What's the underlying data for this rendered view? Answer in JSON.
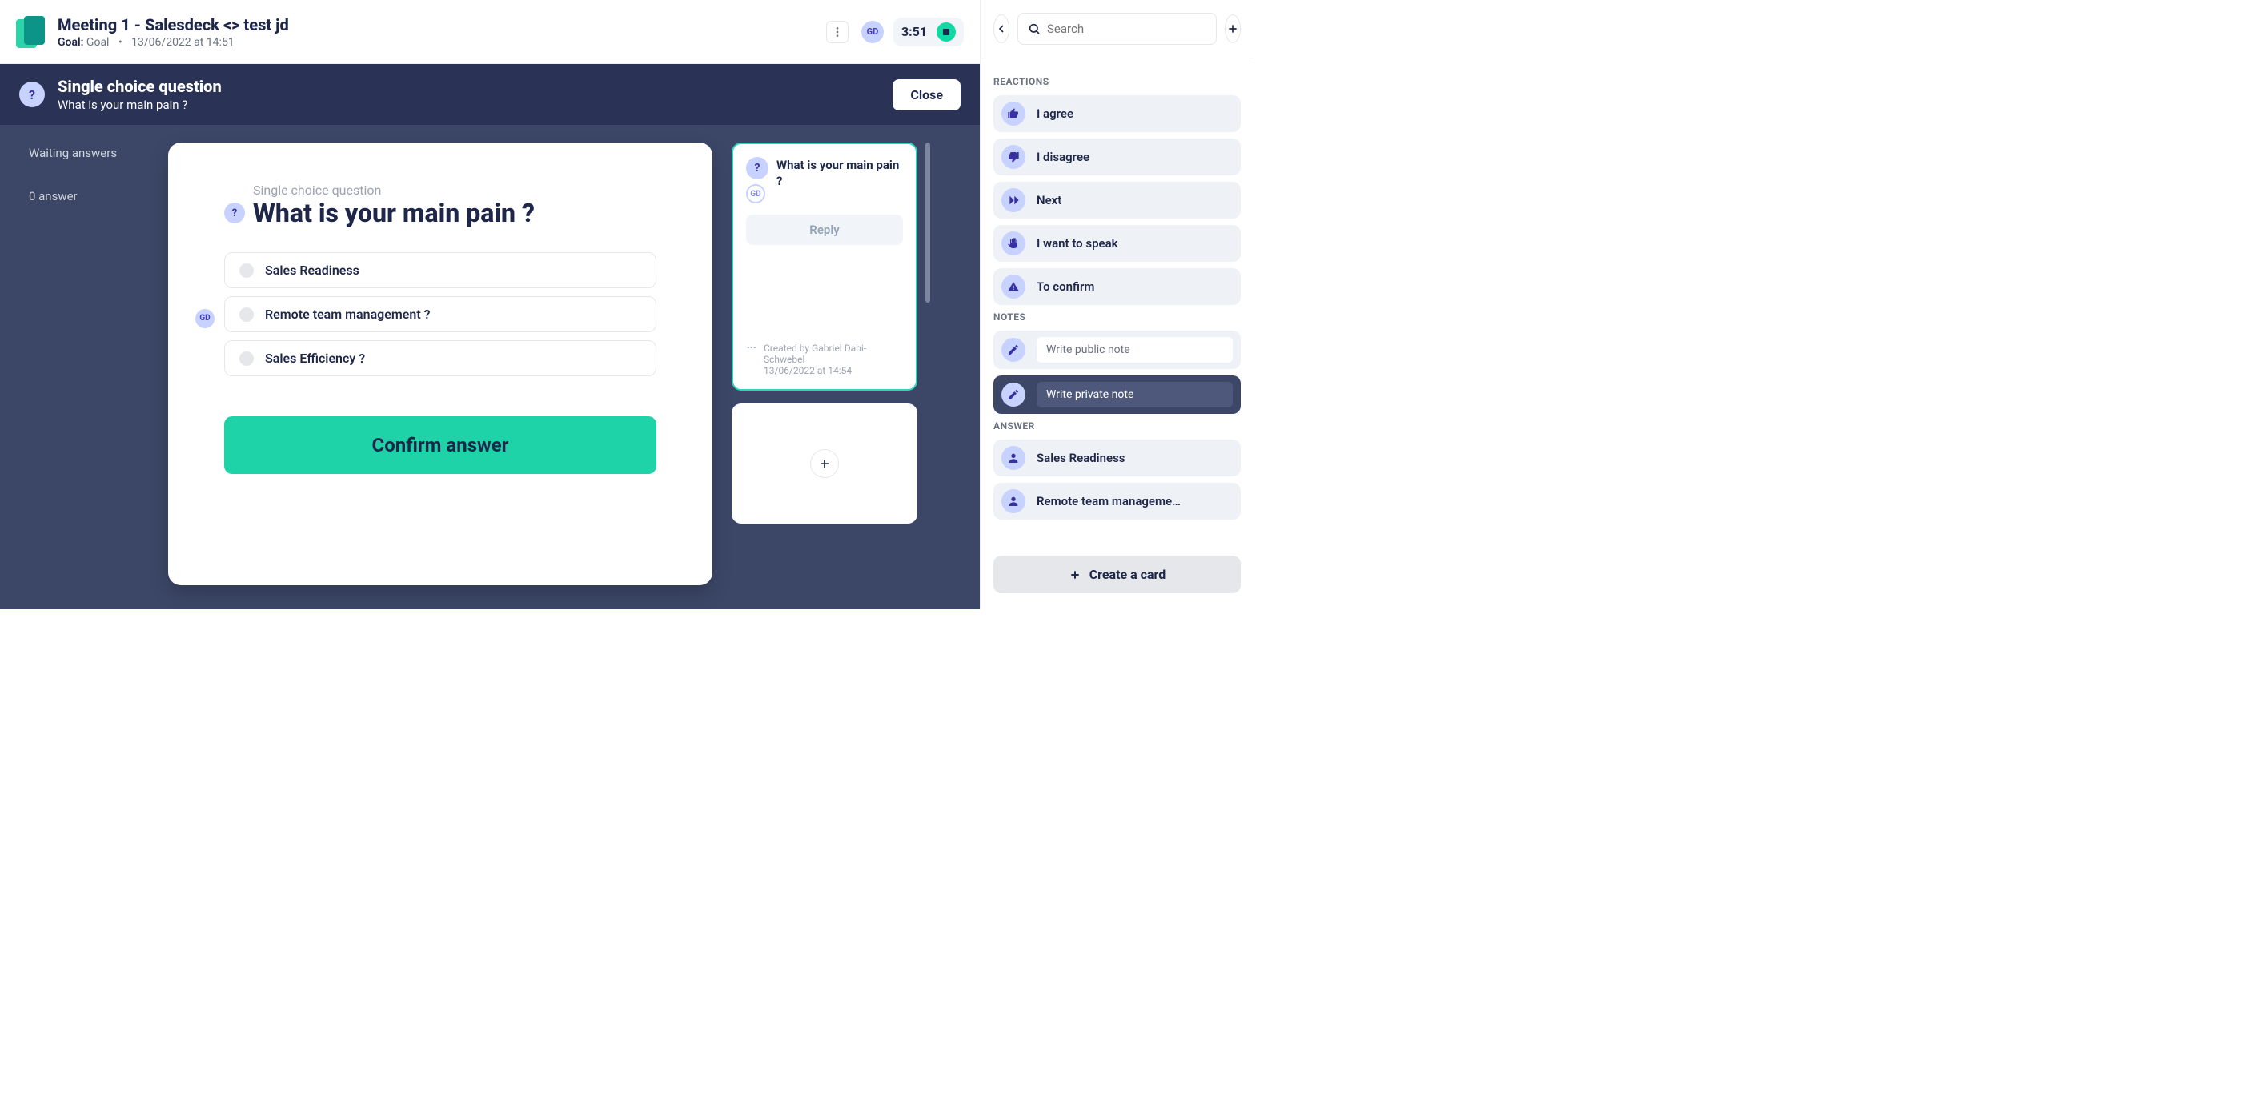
{
  "header": {
    "title": "Meeting 1 - Salesdeck <> test jd",
    "goal_label": "Goal:",
    "goal_value": "Goal",
    "datetime": "13/06/2022 at 14:51",
    "avatar_initials": "GD",
    "timer": "3:51"
  },
  "banner": {
    "title": "Single choice question",
    "subtitle": "What is your main pain ?",
    "close_label": "Close"
  },
  "status": {
    "waiting": "Waiting answers",
    "answers": "0 answer"
  },
  "card": {
    "type": "Single choice question",
    "question": "What is your main pain ?",
    "voter_initials": "GD",
    "options": [
      "Sales Readiness",
      "Remote team management ?",
      "Sales Efficiency ?"
    ],
    "confirm_label": "Confirm answer"
  },
  "feed": {
    "question": "What is your main pain ?",
    "avatar_initials": "GD",
    "reply_label": "Reply",
    "created_by": "Created by Gabriel Dabi-Schwebel",
    "created_at": "13/06/2022 at 14:54"
  },
  "sidebar": {
    "search_placeholder": "Search",
    "sections": {
      "reactions": "REACTIONS",
      "notes": "NOTES",
      "answer": "ANSWER"
    },
    "reactions": [
      {
        "label": "I agree",
        "icon": "thumb-up"
      },
      {
        "label": "I disagree",
        "icon": "thumb-down"
      },
      {
        "label": "Next",
        "icon": "next"
      },
      {
        "label": "I want to speak",
        "icon": "hand"
      },
      {
        "label": "To confirm",
        "icon": "warn"
      }
    ],
    "public_note_placeholder": "Write public note",
    "private_note_placeholder": "Write private note",
    "answers": [
      "Sales Readiness",
      "Remote team manageme…"
    ],
    "create_card_label": "Create a card"
  }
}
